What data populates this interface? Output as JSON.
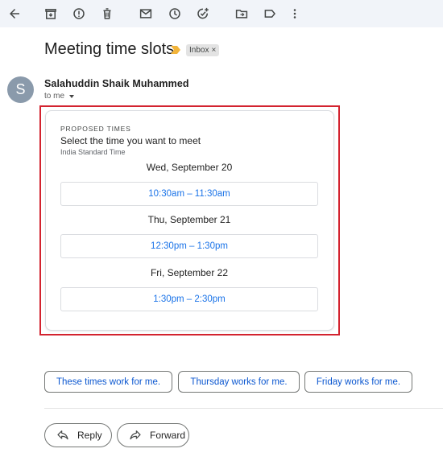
{
  "toolbar": {
    "icons": [
      "back-arrow-icon",
      "archive-icon",
      "report-spam-icon",
      "delete-icon",
      "mark-unread-icon",
      "snooze-icon",
      "add-to-tasks-icon",
      "move-to-icon",
      "label-icon",
      "more-options-icon"
    ]
  },
  "email": {
    "subject": "Meeting time slots",
    "label": "Inbox",
    "label_remove": "×",
    "sender": {
      "initial": "S",
      "name": "Salahuddin Shaik Muhammed"
    },
    "recipient": "to me"
  },
  "proposal": {
    "eyebrow": "PROPOSED TIMES",
    "title": "Select the time you want to meet",
    "timezone": "India Standard Time",
    "days": [
      {
        "label": "Wed, September 20",
        "slot": "10:30am – 11:30am"
      },
      {
        "label": "Thu, September 21",
        "slot": "12:30pm – 1:30pm"
      },
      {
        "label": "Fri, September 22",
        "slot": "1:30pm – 2:30pm"
      }
    ]
  },
  "smart_replies": [
    "These times work for me.",
    "Thursday works for me.",
    "Friday works for me."
  ],
  "actions": {
    "reply": "Reply",
    "forward": "Forward"
  },
  "colors": {
    "highlight": "#d3232f",
    "link_blue": "#1a73e8",
    "chip_blue": "#0b57d0",
    "important_marker": "#f2b43a"
  }
}
